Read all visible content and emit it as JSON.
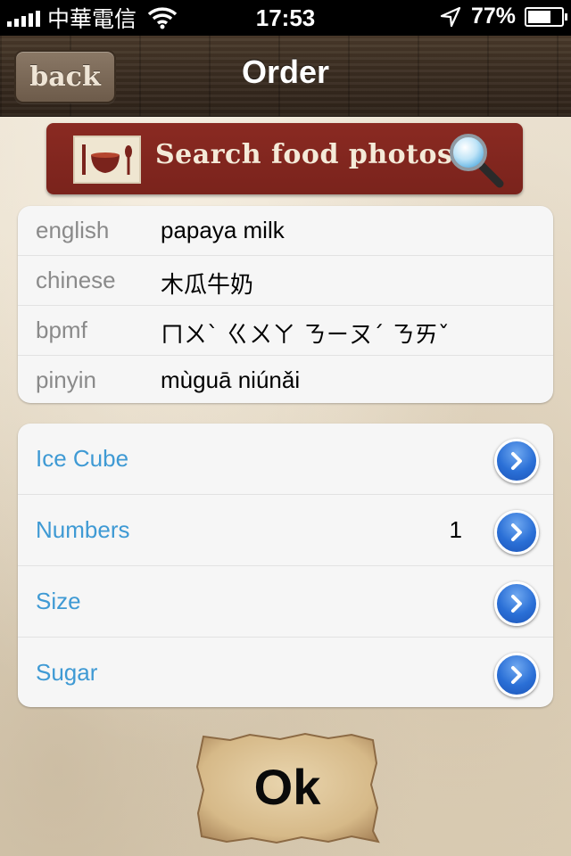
{
  "status_bar": {
    "carrier": "中華電信",
    "time": "17:53",
    "battery": "77%",
    "battery_level": 0.77
  },
  "nav": {
    "back_label": "back",
    "title": "Order"
  },
  "search_banner": {
    "label": "Search food photos."
  },
  "info": {
    "rows": [
      {
        "label": "english",
        "value": "papaya milk"
      },
      {
        "label": "chinese",
        "value": "木瓜牛奶"
      },
      {
        "label": "bpmf",
        "value": "ㄇㄨˋ ㄍㄨㄚ ㄋㄧㄡˊ ㄋㄞˇ"
      },
      {
        "label": "pinyin",
        "value": "mùguā niúnǎi"
      }
    ]
  },
  "options": {
    "rows": [
      {
        "label": "Ice Cube",
        "value": ""
      },
      {
        "label": "Numbers",
        "value": "1"
      },
      {
        "label": "Size",
        "value": ""
      },
      {
        "label": "Sugar",
        "value": ""
      }
    ]
  },
  "ok_button": {
    "label": "Ok"
  },
  "colors": {
    "option_label": "#3f9ad4",
    "banner": "#7a231c",
    "disclosure": "#2a6fd6"
  }
}
